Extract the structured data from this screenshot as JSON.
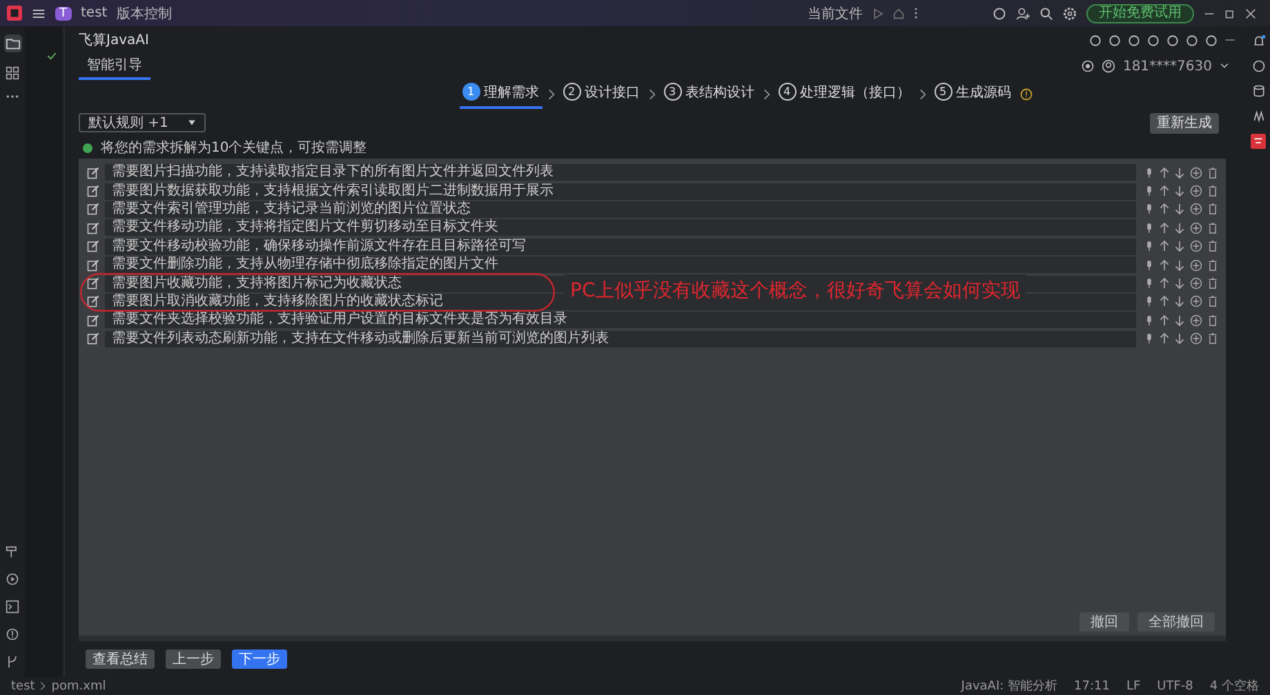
{
  "title_bar": {
    "project_badge": "T",
    "project": "test",
    "vcs": "版本控制",
    "run_config": "当前文件",
    "trial_button": "开始免费试用"
  },
  "plugin": {
    "title": "飞算JavaAI",
    "mode_tab": "智能引导",
    "user": "181****7630",
    "steps": [
      {
        "number": "1",
        "label": "理解需求",
        "selected": true
      },
      {
        "number": "2",
        "label": "设计接口",
        "selected": false
      },
      {
        "number": "3",
        "label": "表结构设计",
        "selected": false
      },
      {
        "number": "4",
        "label": "处理逻辑（接口）",
        "selected": false
      },
      {
        "number": "5",
        "label": "生成源码",
        "selected": false
      }
    ],
    "rule_select": "默认规则 +1",
    "regenerate_button": "重新生成",
    "status_message": "将您的需求拆解为10个关键点，可按需调整",
    "requirements": [
      {
        "text": "需要图片扫描功能，支持读取指定目录下的所有图片文件并返回文件列表"
      },
      {
        "text": "需要图片数据获取功能，支持根据文件索引读取图片二进制数据用于展示"
      },
      {
        "text": "需要文件索引管理功能，支持记录当前浏览的图片位置状态"
      },
      {
        "text": "需要文件移动功能，支持将指定图片文件剪切移动至目标文件夹"
      },
      {
        "text": "需要文件移动校验功能，确保移动操作前源文件存在且目标路径可写"
      },
      {
        "text": "需要文件删除功能，支持从物理存储中彻底移除指定的图片文件"
      },
      {
        "text": "需要图片收藏功能，支持将图片标记为收藏状态"
      },
      {
        "text": "需要图片取消收藏功能，支持移除图片的收藏状态标记"
      },
      {
        "text": "需要文件夹选择校验功能，支持验证用户设置的目标文件夹是否为有效目录"
      },
      {
        "text": "需要文件列表动态刷新功能，支持在文件移动或删除后更新当前可浏览的图片列表"
      }
    ],
    "undo_button": "撤回",
    "undo_all_button": "全部撤回",
    "footer_buttons": [
      {
        "label": "查看总结",
        "primary": false
      },
      {
        "label": "上一步",
        "primary": false
      },
      {
        "label": "下一步",
        "primary": true
      }
    ]
  },
  "annotation": {
    "text": "PC上似乎没有收藏这个概念，很好奇飞算会如何实现"
  },
  "status_bar": {
    "breadcrumbs": [
      "test",
      "pom.xml"
    ],
    "items": [
      "JavaAI: 智能分析",
      "17:11",
      "LF",
      "UTF-8",
      "4 个空格"
    ]
  }
}
